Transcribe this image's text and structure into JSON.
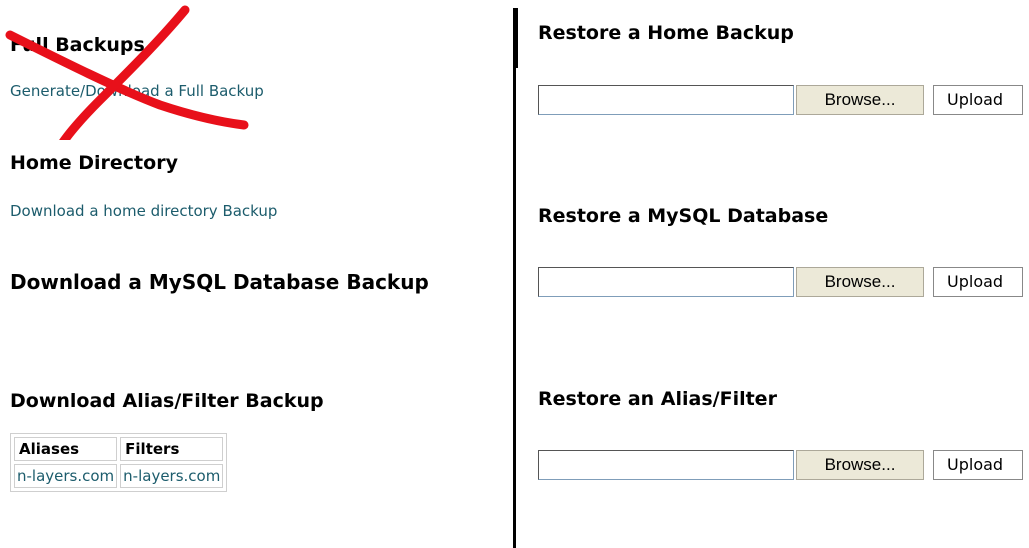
{
  "left": {
    "full_backups": {
      "heading": "Full Backups",
      "link": "Generate/Download a Full Backup"
    },
    "home_directory": {
      "heading": "Home Directory",
      "link": "Download a home directory Backup"
    },
    "mysql_backup": {
      "heading": "Download a MySQL Database Backup"
    },
    "alias_filter": {
      "heading": "Download Alias/Filter Backup",
      "table": {
        "headers": [
          "Aliases",
          "Filters"
        ],
        "row": [
          "n-layers.com",
          "n-layers.com"
        ]
      }
    }
  },
  "right": {
    "restore_home": {
      "heading": "Restore a Home Backup",
      "browse_label": "Browse...",
      "upload_label": "Upload"
    },
    "restore_mysql": {
      "heading": "Restore a MySQL Database",
      "browse_label": "Browse...",
      "upload_label": "Upload"
    },
    "restore_alias": {
      "heading": "Restore an Alias/Filter",
      "browse_label": "Browse...",
      "upload_label": "Upload"
    }
  },
  "colors": {
    "link": "#1c5c6c",
    "strike_mark": "#e8101a"
  },
  "icons": [
    "red-cross-out-mark"
  ]
}
